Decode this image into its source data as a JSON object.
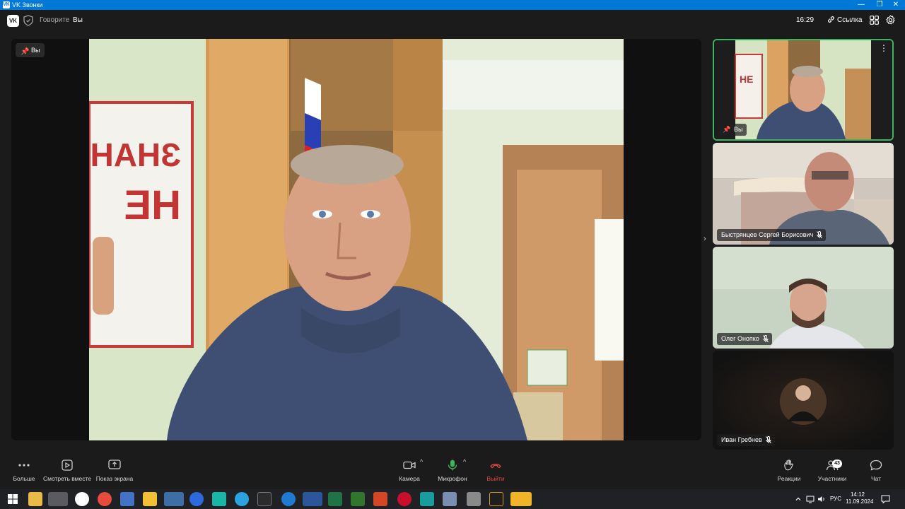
{
  "window": {
    "title": "VK Звонки",
    "minimize_glyph": "—",
    "maximize_glyph": "❐",
    "close_glyph": "✕"
  },
  "header": {
    "speaking_label": "Говорите",
    "speaker_name": "Вы",
    "time": "16:29",
    "link_label": "Ссылка"
  },
  "main": {
    "pin_label": "Вы"
  },
  "tiles": [
    {
      "name": "Вы",
      "muted": false,
      "active": true
    },
    {
      "name": "Быстрянцев Сергей Борисович",
      "muted": true,
      "active": false
    },
    {
      "name": "Олег Онопко",
      "muted": true,
      "active": false
    },
    {
      "name": "Иван Гребнев",
      "muted": true,
      "active": false
    }
  ],
  "toolbar": {
    "more": "Больше",
    "watch_together": "Смотреть вместе",
    "screen_share": "Показ экрана",
    "camera": "Камера",
    "microphone": "Микрофон",
    "leave": "Выйти",
    "reactions": "Реакции",
    "participants": "Участники",
    "participants_count": "43",
    "chat": "Чат"
  },
  "taskbar": {
    "lang": "РУС",
    "time": "14:12",
    "date": "11.09.2024"
  },
  "colors": {
    "accent_green": "#3bb560",
    "leave_red": "#e64646",
    "mic_green": "#3bb560",
    "titlebar_blue": "#0078d7"
  }
}
